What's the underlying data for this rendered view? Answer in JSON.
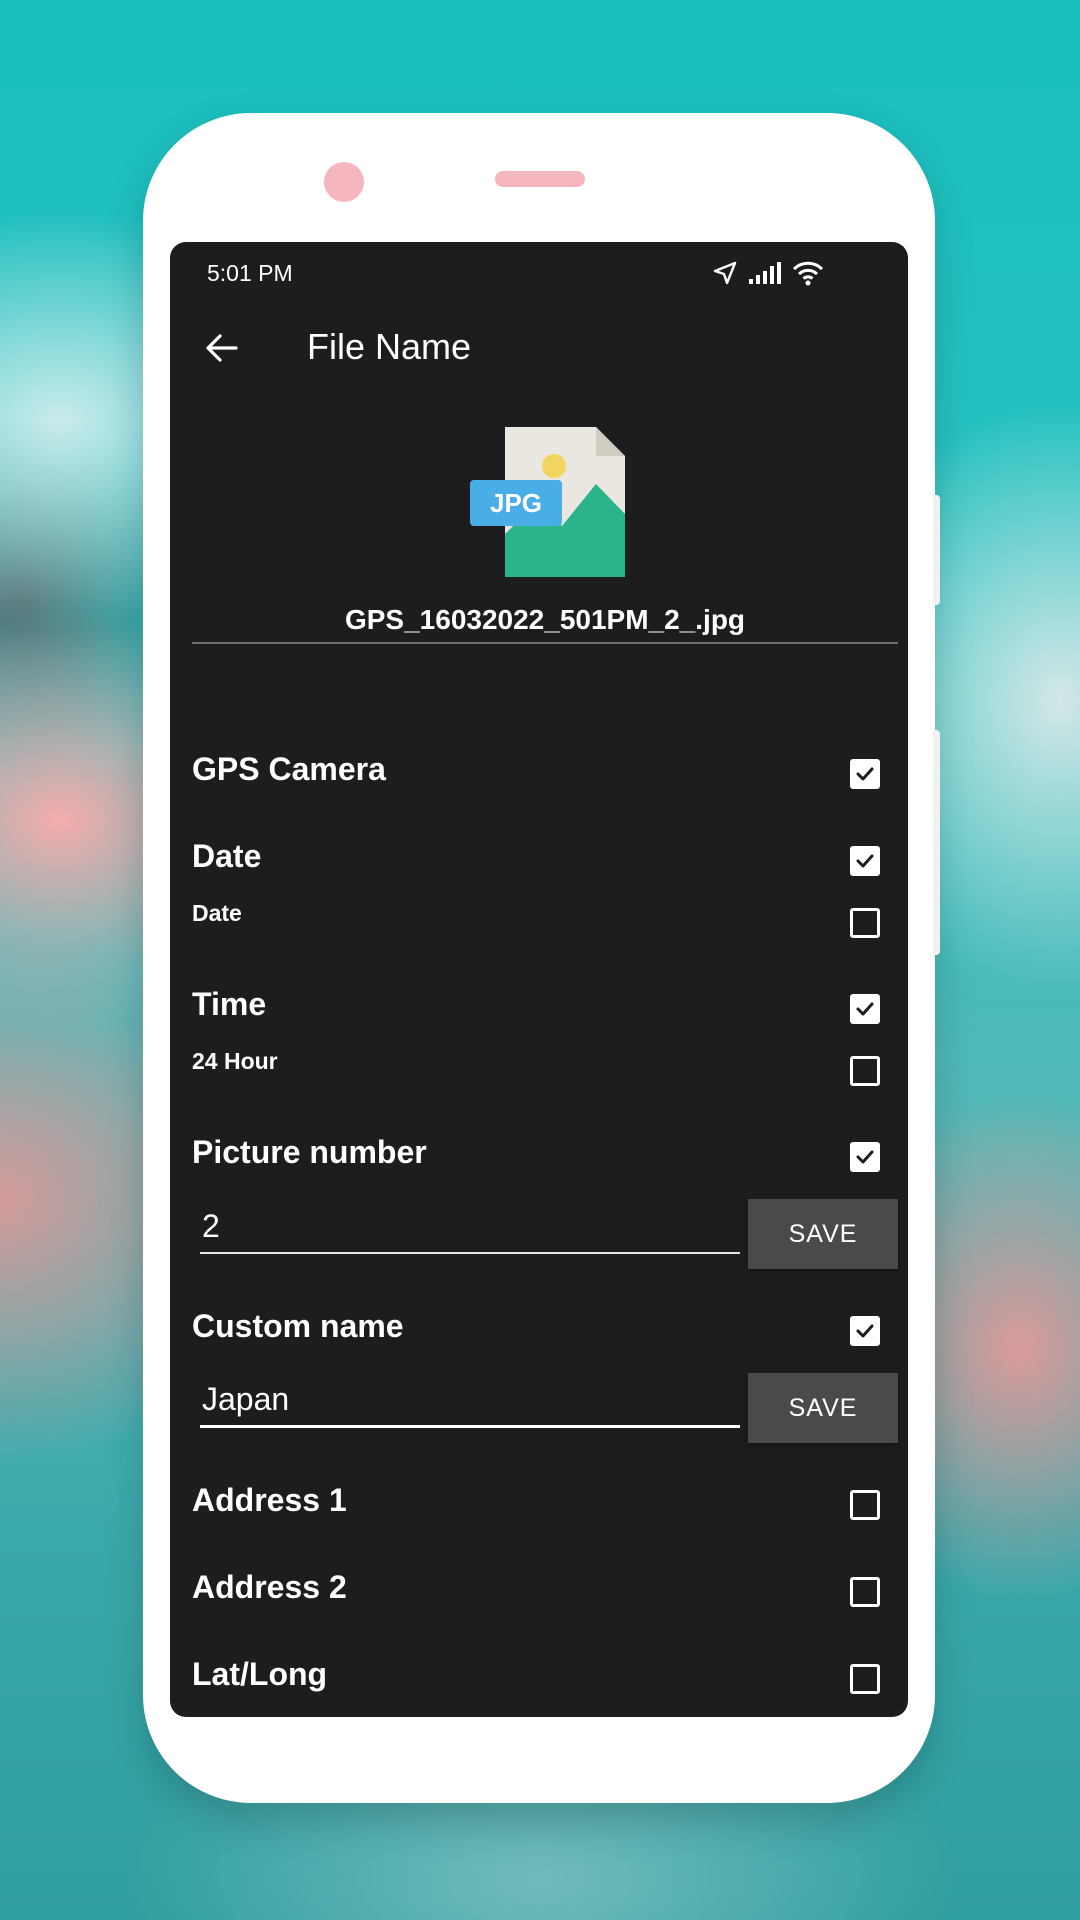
{
  "status_bar": {
    "time": "5:01 PM"
  },
  "toolbar": {
    "title": "File Name"
  },
  "file": {
    "badge": "JPG",
    "name": "GPS_16032022_501PM_2_.jpg"
  },
  "options": {
    "gps_camera": {
      "label": "GPS Camera",
      "checked": true
    },
    "date": {
      "label": "Date",
      "checked": true,
      "sub_label": "Date",
      "sub_checked": false
    },
    "time": {
      "label": "Time",
      "checked": true,
      "sub_label": "24 Hour",
      "sub_checked": false
    },
    "picture_number": {
      "label": "Picture number",
      "checked": true,
      "value": "2",
      "save_label": "SAVE"
    },
    "custom_name": {
      "label": "Custom name",
      "checked": true,
      "value": "Japan",
      "save_label": "SAVE"
    },
    "address1": {
      "label": "Address 1",
      "checked": false
    },
    "address2": {
      "label": "Address 2",
      "checked": false
    },
    "lat_long": {
      "label": "Lat/Long",
      "checked": false
    }
  },
  "colors": {
    "screen_bg": "#1d1c1e",
    "jpg_badge": "#4aaee6",
    "image_green": "#2bb48c",
    "sun_yellow": "#f2d55f",
    "save_button": "#4a4a4c"
  }
}
